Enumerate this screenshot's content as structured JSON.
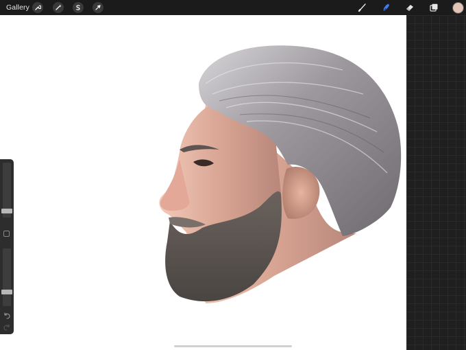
{
  "topbar": {
    "gallery_label": "Gallery",
    "left_tools": [
      "actions-wrench-icon",
      "adjustments-wand-icon",
      "selection-s-icon",
      "transform-arrow-icon"
    ],
    "right_tools": [
      "brush-icon",
      "smudge-icon",
      "eraser-icon",
      "layers-icon"
    ],
    "active_tool": "smudge-icon",
    "active_color": "#e2c3b5",
    "accent_color": "#3d7cf5"
  },
  "sidebar": {
    "brush_size_level": 0.13,
    "opacity_level": 0.22
  }
}
